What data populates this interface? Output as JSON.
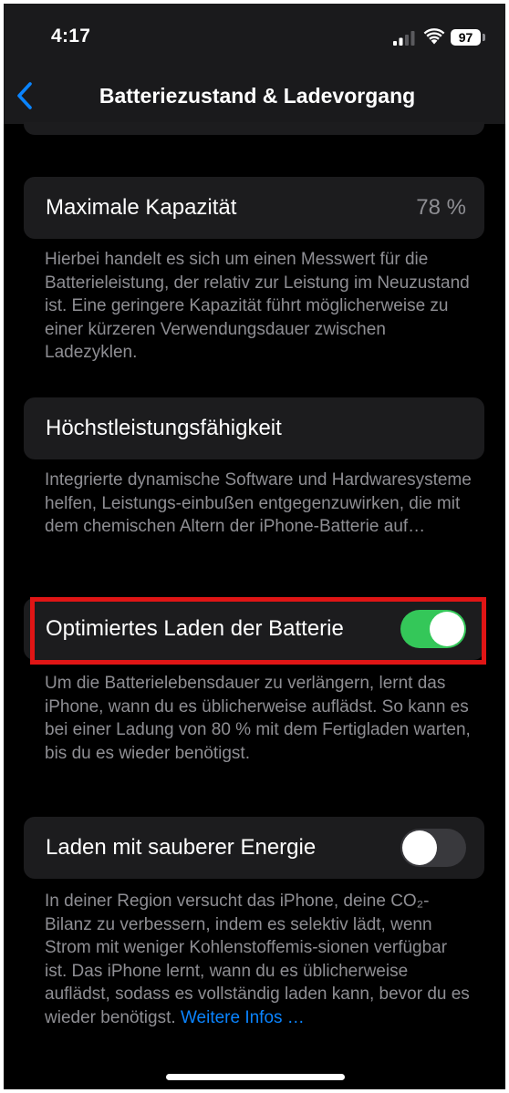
{
  "status_bar": {
    "time": "4:17",
    "battery_level": "97"
  },
  "nav": {
    "title": "Batteriezustand & Ladevorgang"
  },
  "sections": {
    "max_capacity": {
      "label": "Maximale Kapazität",
      "value": "78 %",
      "footer": "Hierbei handelt es sich um einen Messwert für die Batterieleistung, der relativ zur Leistung im Neuzustand ist. Eine geringere Kapazität führt möglicherweise zu einer kürzeren Verwendungsdauer zwischen Ladezyklen."
    },
    "peak_performance": {
      "label": "Höchstleistungsfähigkeit",
      "footer": "Integrierte dynamische Software und Hardwaresysteme helfen, Leistungs-einbußen entgegenzuwirken, die mit dem chemischen Altern der iPhone-Batterie auf…"
    },
    "optimized_charging": {
      "label": "Optimiertes Laden der Batterie",
      "toggle_on": true,
      "footer": "Um die Batterielebensdauer zu verlängern, lernt das iPhone, wann du es üblicherweise auflädst. So kann es bei einer Ladung von 80 % mit dem Fertigladen warten, bis du es wieder benötigst."
    },
    "clean_energy": {
      "label": "Laden mit sauberer Energie",
      "toggle_on": false,
      "footer": "In deiner Region versucht das iPhone, deine CO₂-Bilanz zu verbessern, indem es selektiv lädt, wenn Strom mit weniger Kohlenstoffemis-sionen verfügbar ist. Das iPhone lernt, wann du es üblicherweise auflädst, sodass es vollständig laden kann, bevor du es wieder benötigst.",
      "link": "Weitere Infos …"
    }
  },
  "colors": {
    "accent": "#0a84ff",
    "toggle_on": "#34c759",
    "highlight_border": "#e01515",
    "background": "#000000",
    "cell_background": "#1c1c1e"
  },
  "icons": {
    "back": "chevron-left-icon",
    "signal": "cellular-signal-icon",
    "wifi": "wifi-icon",
    "battery": "battery-icon"
  }
}
